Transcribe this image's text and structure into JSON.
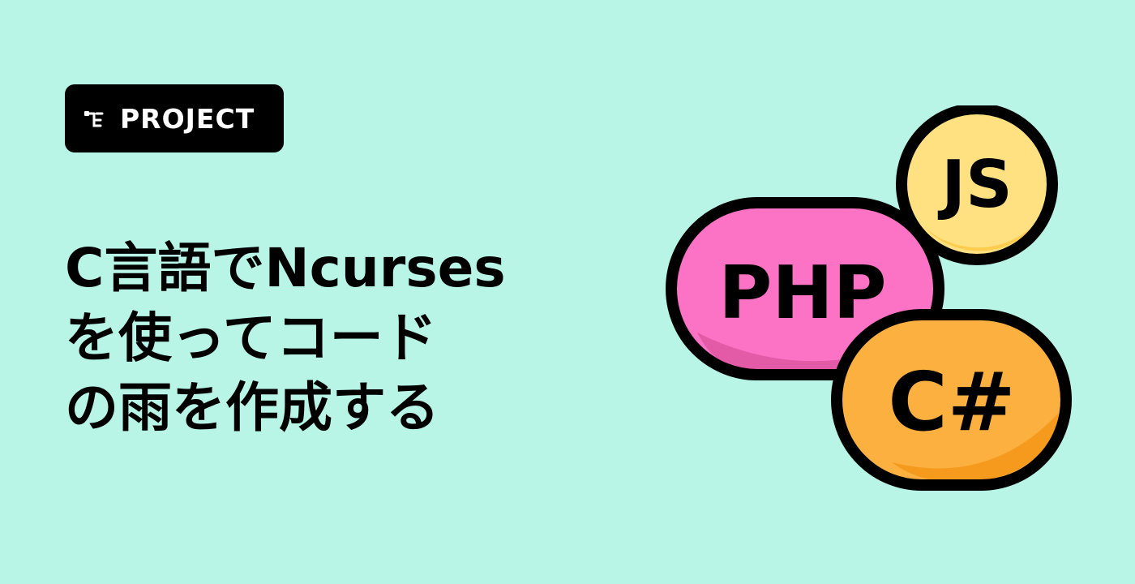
{
  "badge": {
    "icon": "project-tree-icon",
    "label": "PROJECT"
  },
  "title": {
    "lines": [
      "C言語でNcurses",
      "を使ってコード",
      "の雨を作成する"
    ]
  },
  "illustration": {
    "bubbles": [
      {
        "label": "JS",
        "icon": "js-bubble-icon",
        "color": "#ffe182"
      },
      {
        "label": "PHP",
        "icon": "php-bubble-icon",
        "color": "#fc72c4"
      },
      {
        "label": "C#",
        "icon": "csharp-bubble-icon",
        "color": "#fbb040"
      }
    ]
  },
  "colors": {
    "background": "#b8f5e7",
    "badge_bg": "#000000",
    "text": "#000000",
    "outline": "#000000"
  }
}
